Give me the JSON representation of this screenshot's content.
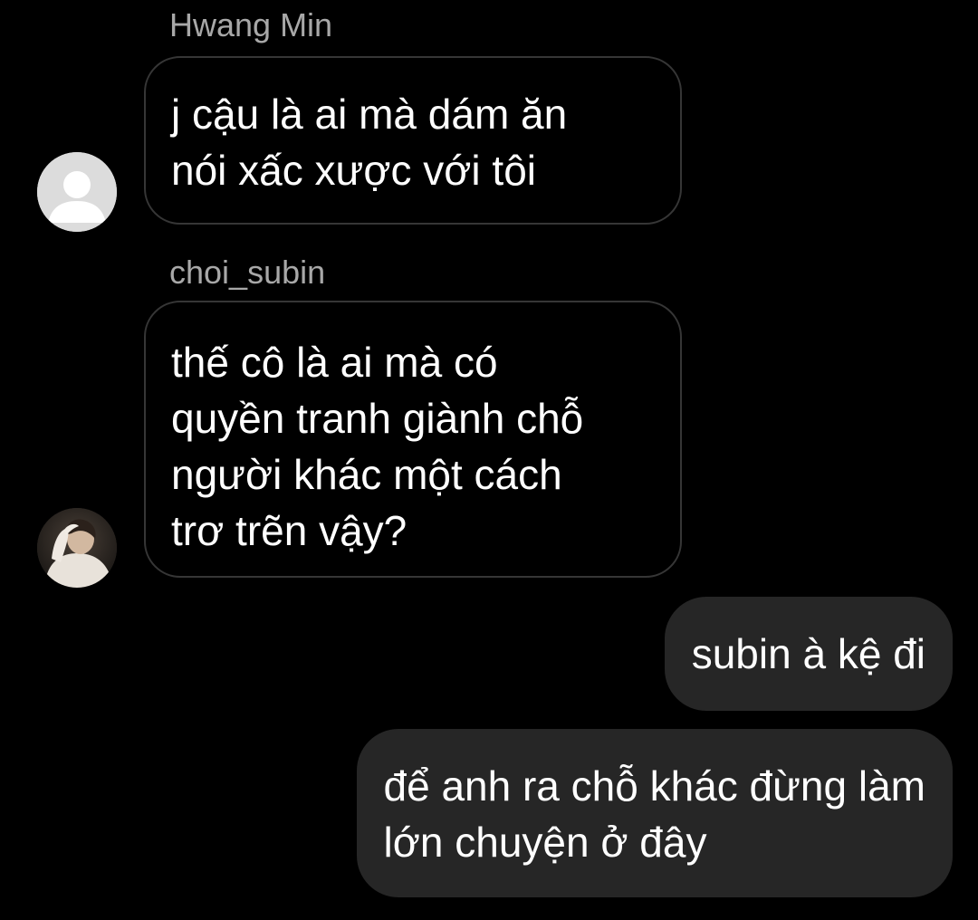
{
  "messages": [
    {
      "sender": "Hwang Min",
      "avatar": "default-user-avatar",
      "lines": [
        "j cậu là ai mà dám ăn",
        "nói xấc xược với tôi"
      ]
    },
    {
      "sender": "choi_subin",
      "avatar": "user-photo-avatar",
      "lines": [
        "thế cô là ai mà có",
        "quyền tranh giành chỗ",
        "người khác một cách",
        "trơ trẽn vậy?"
      ]
    },
    {
      "sender": "",
      "outgoing": true,
      "lines": [
        "subin à kệ đi"
      ]
    },
    {
      "sender": "",
      "outgoing": true,
      "lines": [
        "để anh ra chỗ khác đừng làm",
        "lớn chuyện ở đây"
      ]
    }
  ],
  "colors": {
    "background": "#000000",
    "incoming_border": "#363636",
    "outgoing_bubble": "#262626",
    "sender_name": "#a8a8a8",
    "text": "#ffffff"
  }
}
